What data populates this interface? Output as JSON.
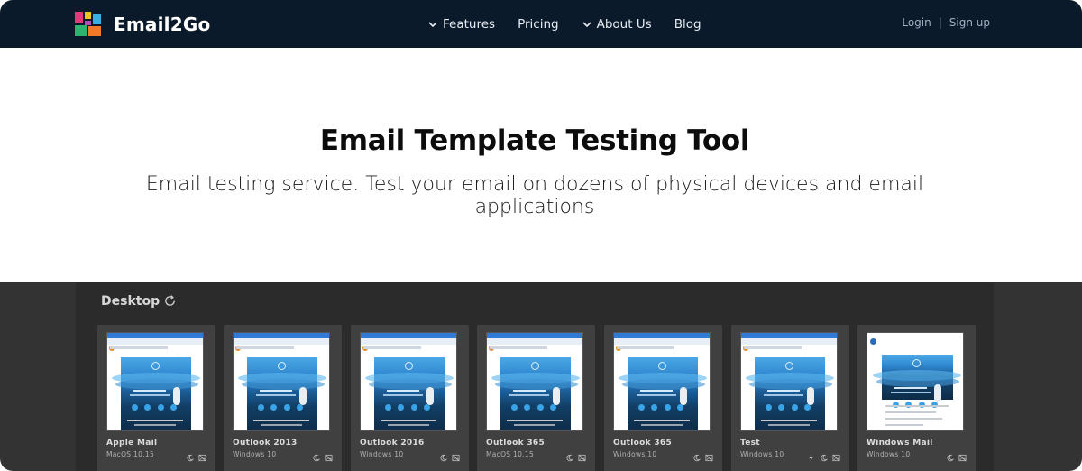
{
  "brand": {
    "name": "Email2Go",
    "logo_colors": [
      "#e23a78",
      "#f0c31d",
      "#3ab0e0",
      "#2db36f",
      "#f07a2a"
    ]
  },
  "nav": {
    "items": [
      {
        "label": "Features",
        "dropdown": true
      },
      {
        "label": "Pricing",
        "dropdown": false
      },
      {
        "label": "About Us",
        "dropdown": true
      },
      {
        "label": "Blog",
        "dropdown": false
      }
    ],
    "login": "Login",
    "separator": "|",
    "signup": "Sign up"
  },
  "hero": {
    "title": "Email Template Testing Tool",
    "subtitle": "Email testing service. Test your email on dozens of physical devices and email applications"
  },
  "desktop": {
    "title": "Desktop",
    "refresh_icon": "refresh-icon",
    "clients": [
      {
        "name": "Apple Mail",
        "os": "MacOS 10.15",
        "icons": [
          "moon-icon",
          "image-off-icon"
        ]
      },
      {
        "name": "Outlook 2013",
        "os": "Windows 10",
        "icons": [
          "moon-icon",
          "image-off-icon"
        ]
      },
      {
        "name": "Outlook 2016",
        "os": "Windows 10",
        "icons": [
          "moon-icon",
          "image-off-icon"
        ]
      },
      {
        "name": "Outlook 365",
        "os": "MacOS 10.15",
        "icons": [
          "moon-icon",
          "image-off-icon"
        ]
      },
      {
        "name": "Outlook 365",
        "os": "Windows 10",
        "icons": [
          "moon-icon",
          "image-off-icon"
        ]
      },
      {
        "name": "Test",
        "os": "Windows 10",
        "icons": [
          "bolt-icon",
          "moon-icon",
          "image-off-icon"
        ]
      },
      {
        "name": "Windows Mail",
        "os": "Windows 10",
        "icons": [
          "moon-icon",
          "image-off-icon"
        ]
      }
    ]
  },
  "colors": {
    "nav_bg": "#0b1a2a",
    "dark_bg": "#333333",
    "card_bg": "#404040",
    "mail_blue": "#2f87cf"
  }
}
